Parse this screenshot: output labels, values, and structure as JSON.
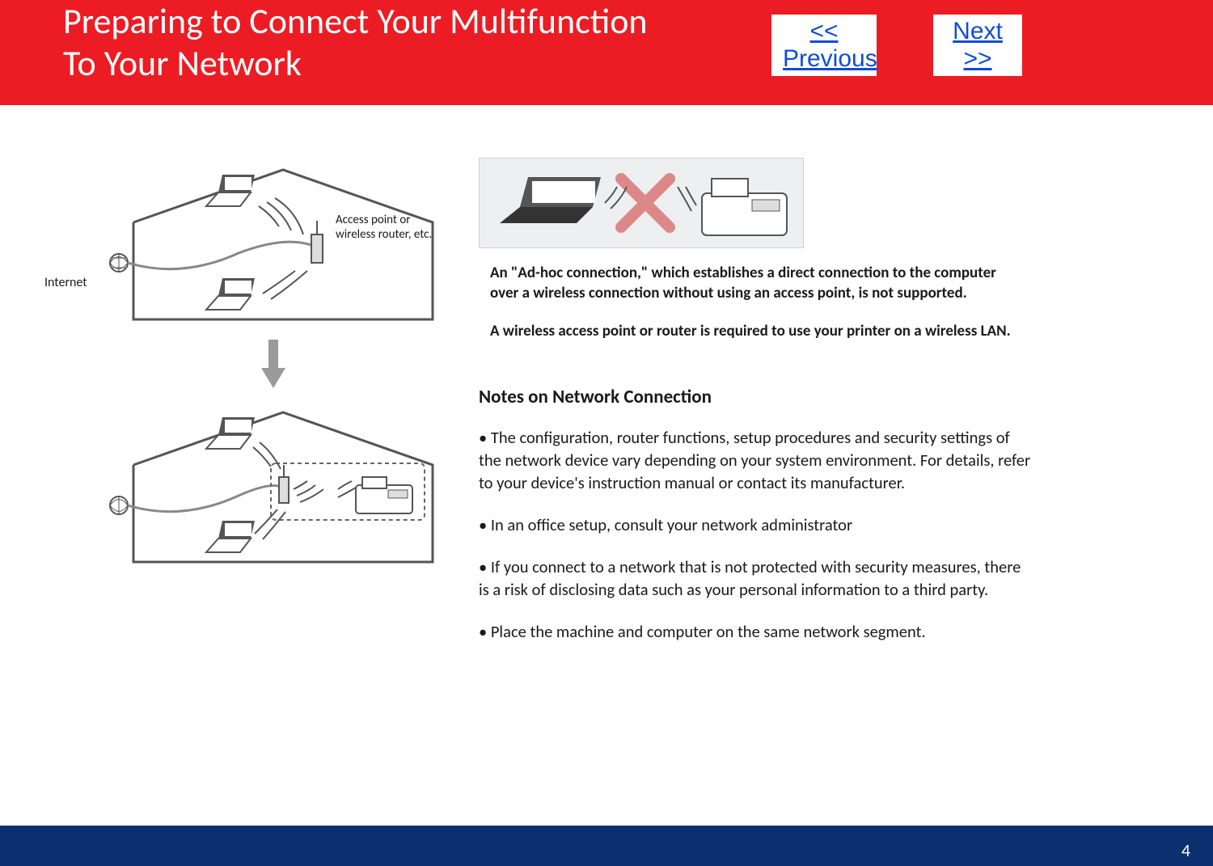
{
  "header": {
    "title_line1": "Preparing to Connect Your Multifunction",
    "title_line2": "To Your Network",
    "prev_label": "<< Previous",
    "next_label": "Next >>"
  },
  "left": {
    "internet_label": "Internet",
    "ap_label_line1": "Access point or",
    "ap_label_line2": "wireless router, etc."
  },
  "right": {
    "adhoc_note": "An \"Ad-hoc connection,\" which establishes a direct connection to the computer over a wireless connection without using an access point, is not supported.",
    "req_note": "A wireless access point or router is required to use your printer on a wireless LAN.",
    "section_title": "Notes on Network Connection",
    "bullets": [
      "• The configuration, router functions, setup procedures and security settings of the network device vary depending on your system environment. For details, refer to your device's instruction manual or contact its manufacturer.",
      "• In an office setup, consult your network administrator",
      "• If you connect to a network that is not protected with security measures, there is a risk of disclosing data such as your personal information to a third party.",
      "• Place the machine and computer on the same network segment."
    ]
  },
  "footer": {
    "page_number": "4"
  }
}
